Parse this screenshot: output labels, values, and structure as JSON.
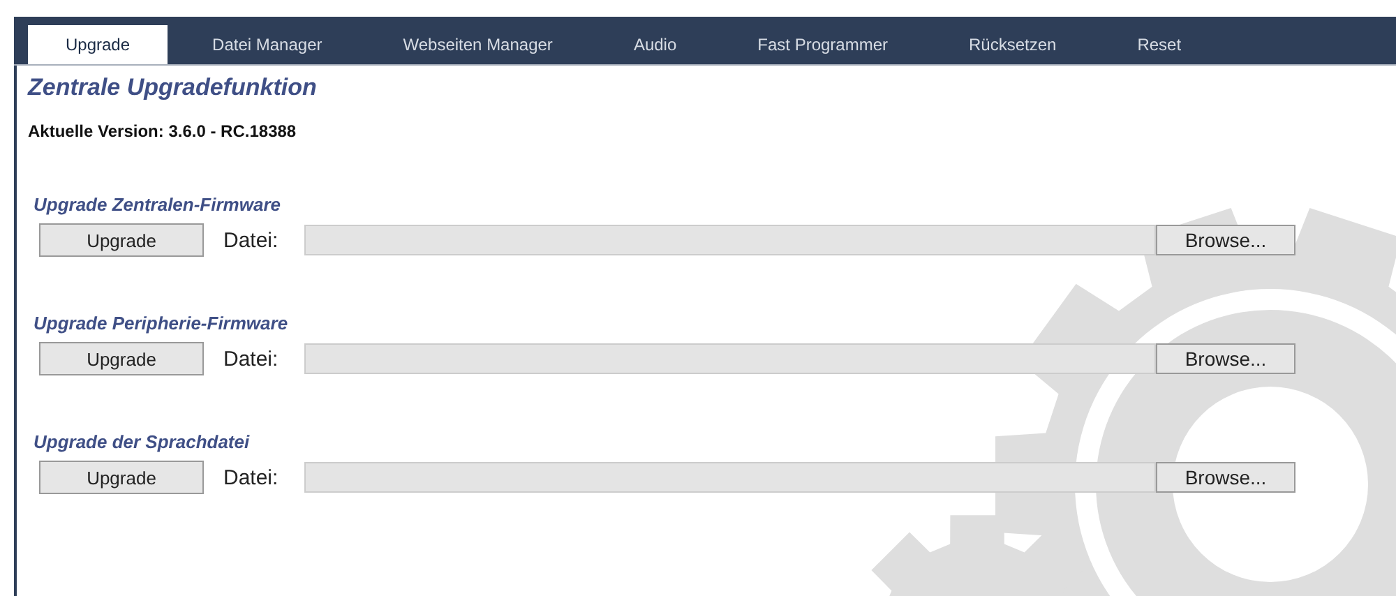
{
  "tabs": [
    {
      "label": "Upgrade",
      "selected": true
    },
    {
      "label": "Datei Manager",
      "selected": false
    },
    {
      "label": "Webseiten Manager",
      "selected": false
    },
    {
      "label": "Audio",
      "selected": false
    },
    {
      "label": "Fast Programmer",
      "selected": false
    },
    {
      "label": "Rücksetzen",
      "selected": false
    },
    {
      "label": "Reset",
      "selected": false
    }
  ],
  "title": "Zentrale Upgradefunktion",
  "version": "Aktuelle Version: 3.6.0 - RC.18388",
  "sections": [
    {
      "heading": "Upgrade Zentralen-Firmware",
      "button": "Upgrade",
      "file_label": "Datei:",
      "browse": "Browse..."
    },
    {
      "heading": "Upgrade Peripherie-Firmware",
      "button": "Upgrade",
      "file_label": "Datei:",
      "browse": "Browse..."
    },
    {
      "heading": "Upgrade der Sprachdatei",
      "button": "Upgrade",
      "file_label": "Datei:",
      "browse": "Browse..."
    }
  ]
}
